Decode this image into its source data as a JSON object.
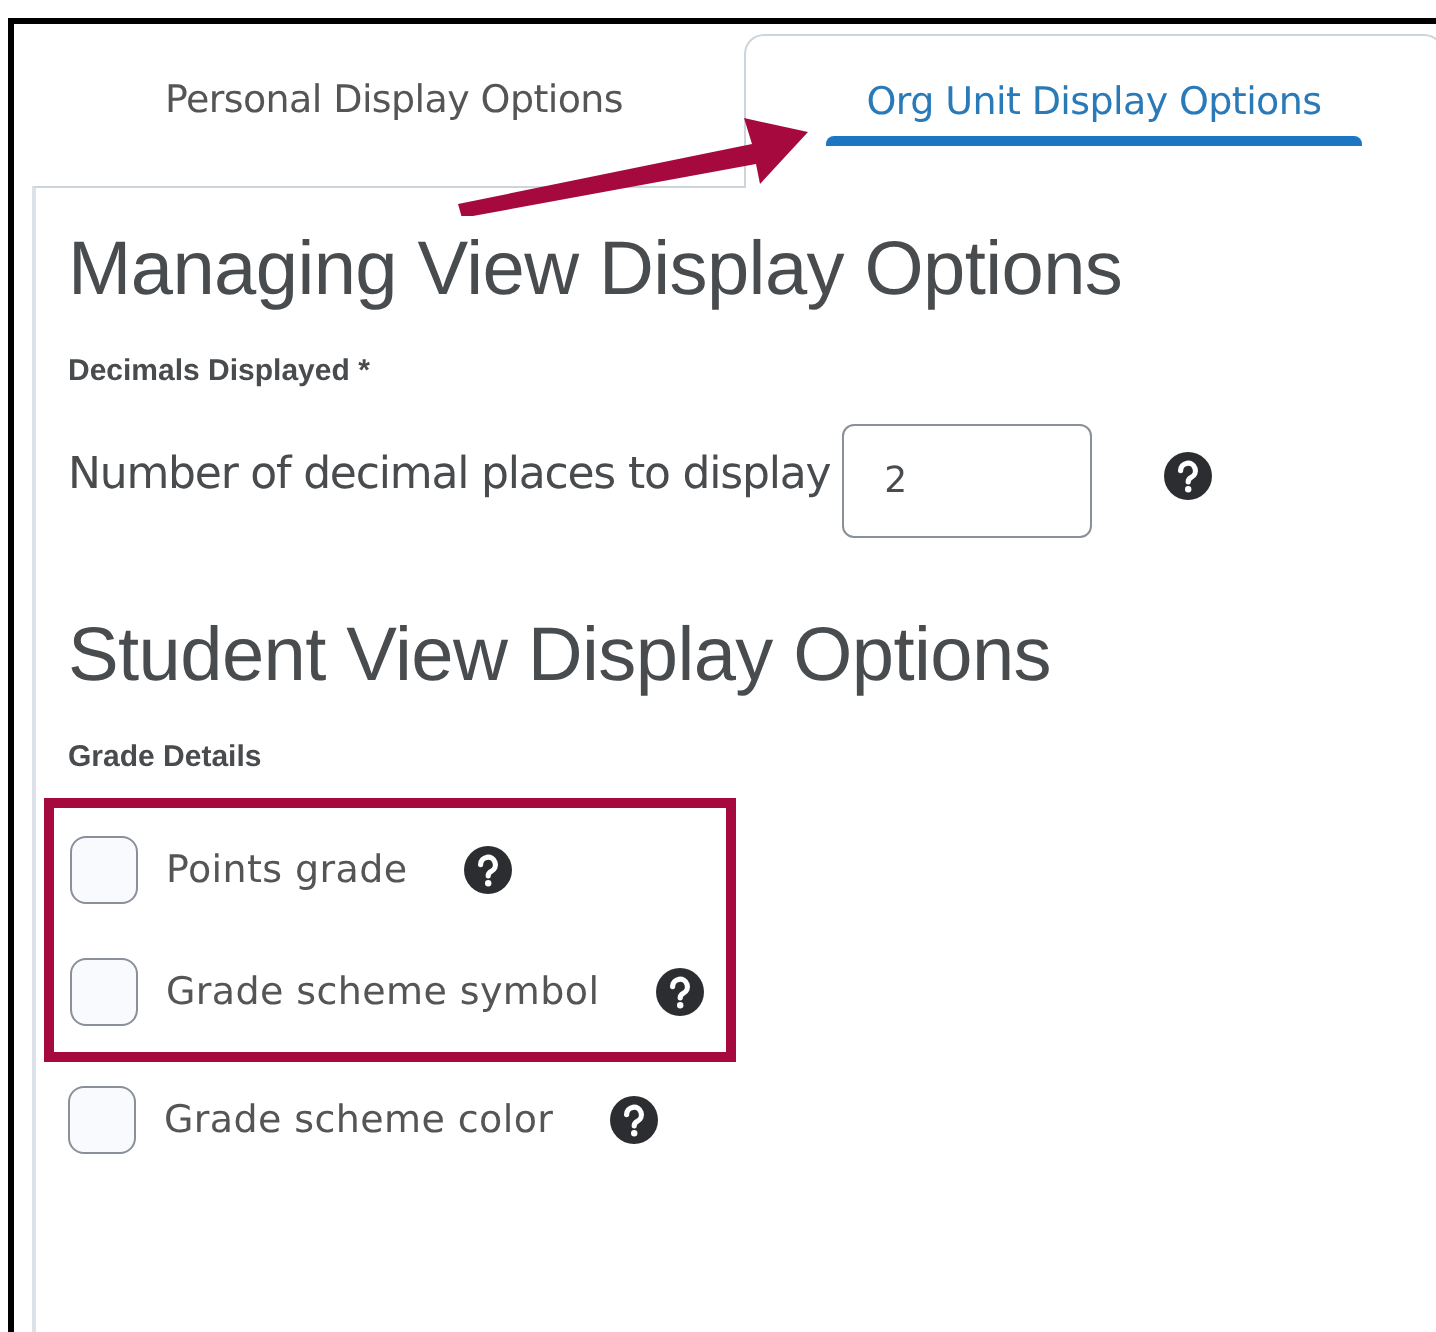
{
  "tabs": [
    {
      "label": "Personal Display Options",
      "selected": false
    },
    {
      "label": "Org Unit Display Options",
      "selected": true
    }
  ],
  "sections": [
    {
      "heading": "Managing View Display Options",
      "group_label": "Decimals Displayed *",
      "fields": [
        {
          "label": "Number of decimal places to display",
          "value": "2"
        }
      ]
    },
    {
      "heading": "Student View Display Options",
      "group_label": "Grade Details",
      "options": [
        {
          "label": "Points grade",
          "checked": false,
          "highlighted": true
        },
        {
          "label": "Grade scheme symbol",
          "checked": false,
          "highlighted": true
        },
        {
          "label": "Grade scheme color",
          "checked": false,
          "highlighted": false
        }
      ]
    }
  ]
}
